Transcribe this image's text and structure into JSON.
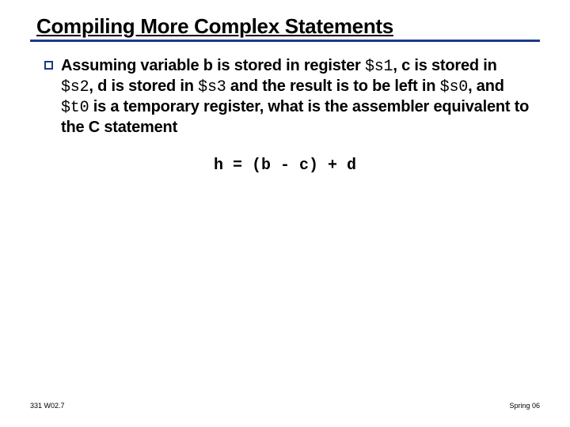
{
  "title": "Compiling More Complex Statements",
  "bullet": {
    "part1": "Assuming variable b is stored in register ",
    "reg1": "$s1",
    "part2": ", c is stored in ",
    "reg2": "$s2",
    "part3": ", d is stored in ",
    "reg3": "$s3",
    "part4": " and the result is to be left in ",
    "reg4": "$s0",
    "part5": ", and ",
    "reg5": "$t0",
    "part6": " is a temporary register, what is the assembler equivalent to the C statement"
  },
  "code": "h = (b - c) + d",
  "footer": {
    "left": "331 W02.7",
    "right": "Spring 06"
  }
}
